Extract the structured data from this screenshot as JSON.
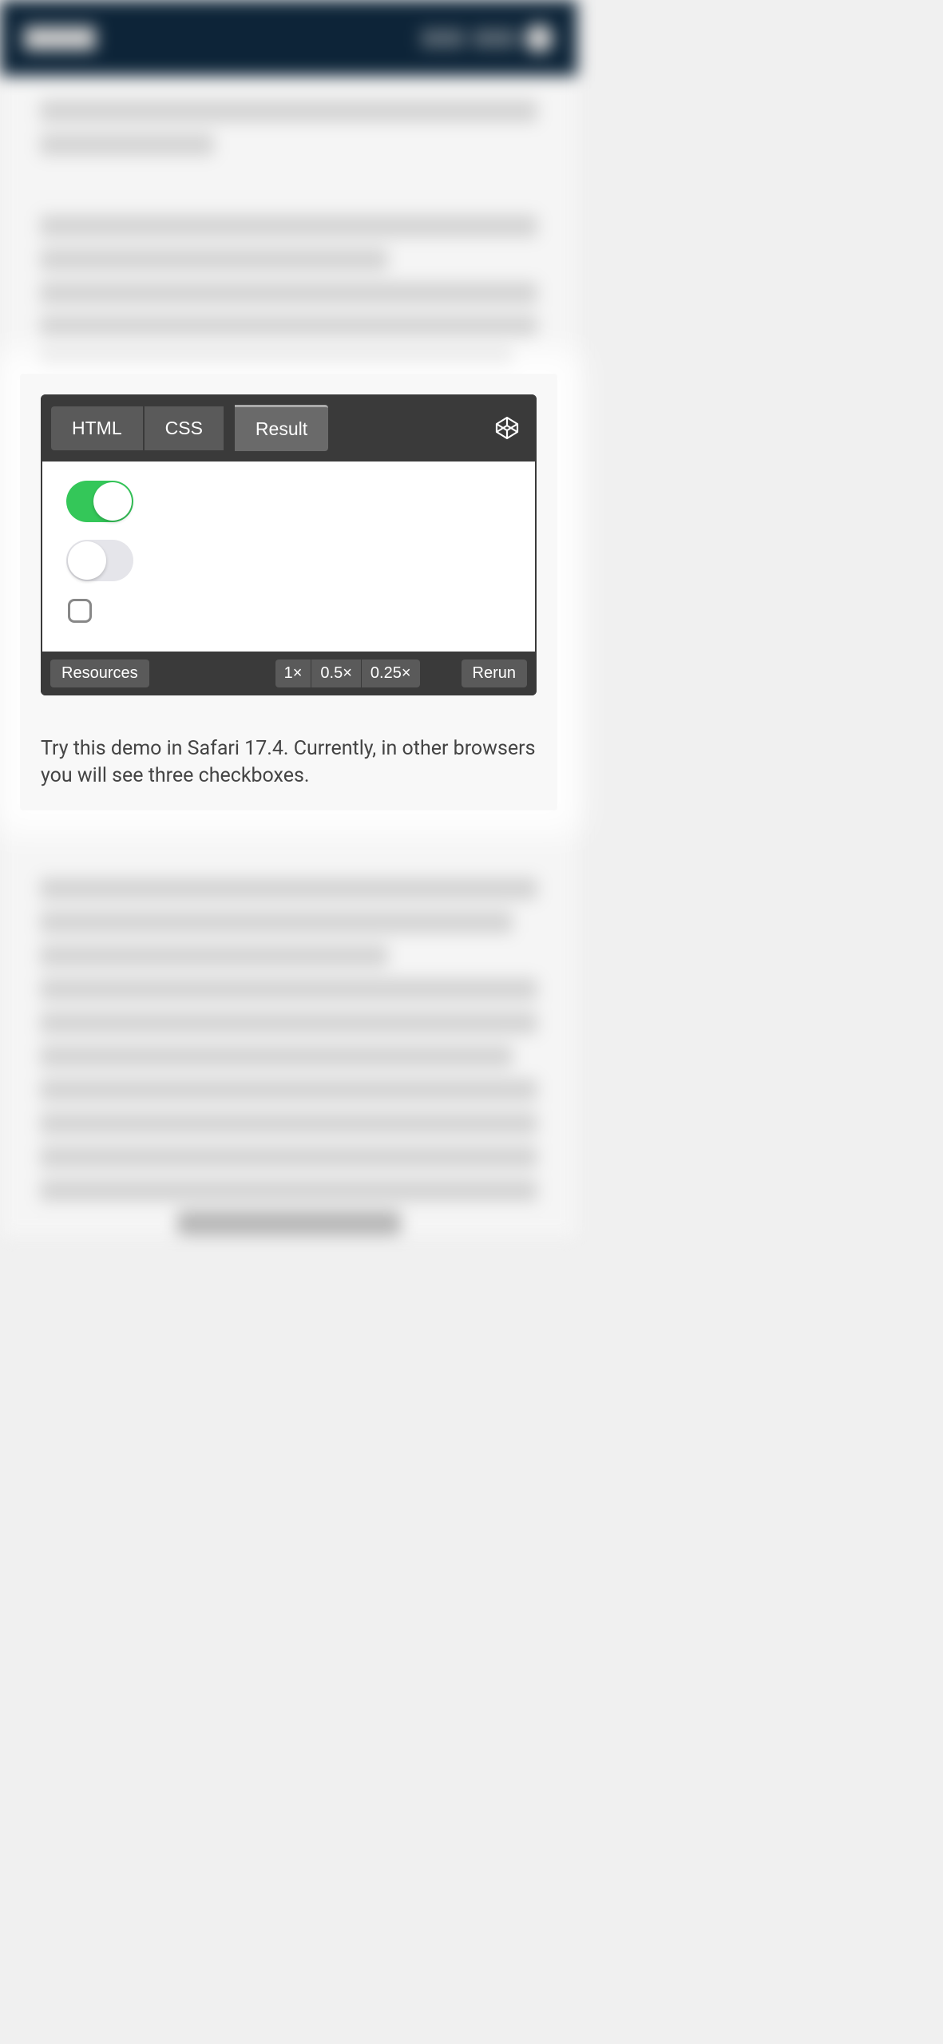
{
  "demo": {
    "tabs": {
      "html": "HTML",
      "css": "CSS",
      "result": "Result"
    },
    "switches": {
      "on_state": true,
      "off_state": false,
      "checkbox_state": false
    },
    "footer": {
      "resources": "Resources",
      "zoom1": "1×",
      "zoom05": "0.5×",
      "zoom025": "0.25×",
      "rerun": "Rerun"
    },
    "caption": "Try this demo in Safari 17.4. Currently, in other browsers you will see three checkboxes."
  }
}
